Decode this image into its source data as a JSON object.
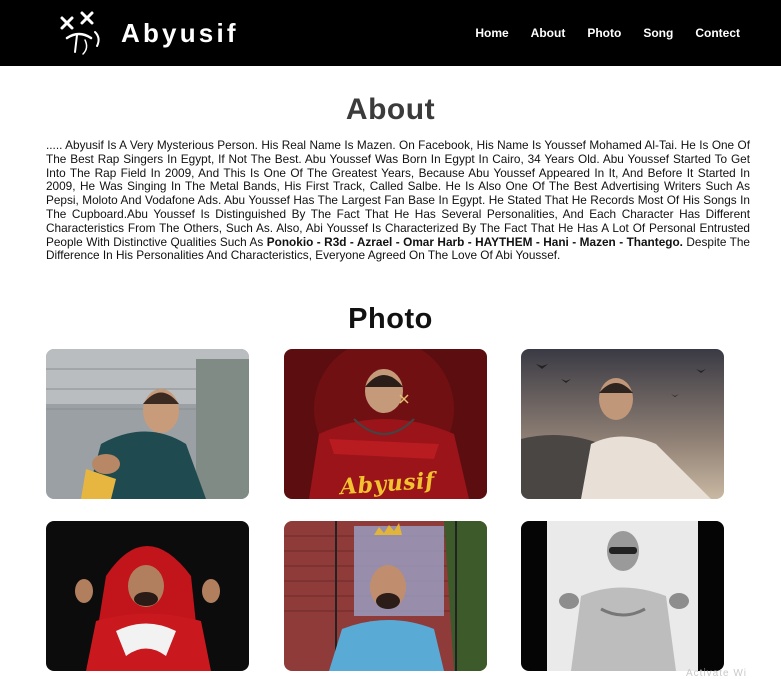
{
  "brand": {
    "logo_icon": "crossed-eyes-face-icon",
    "name": "Abyusif"
  },
  "nav": {
    "items": [
      {
        "label": "Home"
      },
      {
        "label": "About"
      },
      {
        "label": "Photo"
      },
      {
        "label": "Song"
      },
      {
        "label": "Contect"
      }
    ]
  },
  "about": {
    "title": "About",
    "text_before": "..... Abyusif Is A Very Mysterious Person. His Real Name Is Mazen. On Facebook, His Name Is Youssef Mohamed Al-Tai. He Is One Of The Best Rap Singers In Egypt, If Not The Best. Abu Youssef Was Born In Egypt In Cairo, 34 Years Old. Abu Youssef Started To Get Into The Rap Field In 2009, And This Is One Of The Greatest Years, Because Abu Youssef Appeared In It, And Before It Started In 2009, He Was Singing In The Metal Bands, His First Track, Called Salbe. He Is Also One Of The Best Advertising Writers Such As Pepsi, Moloto And Vodafone Ads. Abu Youssef Has The Largest Fan Base In Egypt. He Stated That He Records Most Of His Songs In The Cupboard.Abu Youssef Is Distinguished By The Fact That He Has Several Personalities, And Each Character Has Different Characteristics From The Others, Such As. Also, Abi Youssef Is Characterized By The Fact That He Has A Lot Of Personal Entrusted People With Distinctive Qualities Such As ",
    "bold_names": "Ponokio - R3d - Azrael - Omar Harb - HAYTHEM - Hani - Mazen - Thantego.",
    "text_after": " Despite The Difference In His Personalities And Characteristics, Everyone Agreed On The Love Of Abi Youssef."
  },
  "photo": {
    "title": "Photo",
    "items": [
      {
        "name": "photo-1",
        "overlay_text": ""
      },
      {
        "name": "photo-2",
        "overlay_text": "Abyusif"
      },
      {
        "name": "photo-3",
        "overlay_text": ""
      },
      {
        "name": "photo-4",
        "overlay_text": ""
      },
      {
        "name": "photo-5",
        "overlay_text": ""
      },
      {
        "name": "photo-6",
        "overlay_text": ""
      }
    ]
  },
  "footer_ghost": "Activate Wi",
  "colors": {
    "navbar_bg": "#000000",
    "page_bg": "#ffffff",
    "about_title": "#3b3b3b",
    "album_title_yellow": "#f2c230"
  }
}
